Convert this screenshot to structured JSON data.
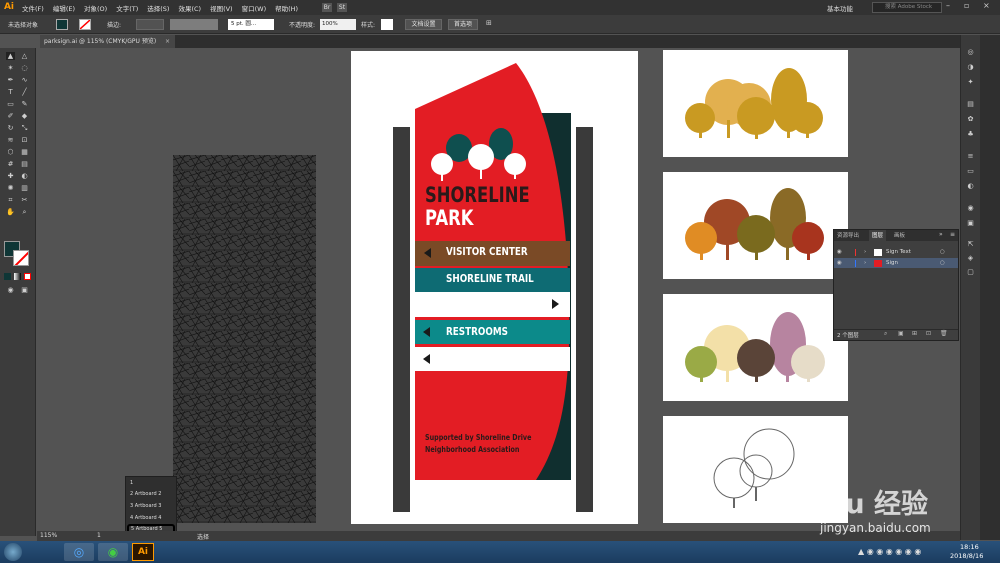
{
  "menubar": {
    "logo": "Ai",
    "items": [
      "文件(F)",
      "编辑(E)",
      "对象(O)",
      "文字(T)",
      "选择(S)",
      "效果(C)",
      "视图(V)",
      "窗口(W)",
      "帮助(H)"
    ],
    "br": "Br",
    "st": "St",
    "workspace": "基本功能",
    "search_placeholder": "搜索 Adobe Stock"
  },
  "control": {
    "selection": "未选择对象",
    "stroke_label": "描边:",
    "brush": "5 pt. 圆...",
    "opacity_label": "不透明度:",
    "opacity": "100%",
    "style_label": "样式:",
    "doc_setup": "文档设置",
    "prefs": "首选项"
  },
  "tab": {
    "title": "parksign.ai @ 115% (CMYK/GPU 预览)"
  },
  "sign": {
    "line1": "SHORELINE",
    "line2": "PARK",
    "visitor": "VISITOR CENTER",
    "trail": "SHORELINE TRAIL",
    "restrooms": "RESTROOMS",
    "support1": "Supported by Shoreline Drive",
    "support2": "Neighborhood Association"
  },
  "layers": {
    "tabs": [
      "资源导出",
      "图层",
      "画板"
    ],
    "rows": [
      "Sign Text",
      "Sign"
    ],
    "count": "2 个图层"
  },
  "artboards": {
    "items": [
      "1",
      "2 Artboard 2",
      "3 Artboard 3",
      "4 Artboard 4",
      "5 Artboard 5"
    ]
  },
  "status": {
    "zoom": "115%",
    "page": "1",
    "mode": "选择"
  },
  "taskbar": {
    "time": "18:16",
    "date": "2018/8/16",
    "ai": "Ai"
  },
  "watermark": {
    "brand": "Baidu 经验",
    "url": "jingyan.baidu.com"
  },
  "colors": {
    "red": "#e31d24",
    "brown": "#7a4a26",
    "teal": "#0e6b73",
    "darkgreen": "#0f2f2f",
    "aqua": "#0c8a8a"
  }
}
